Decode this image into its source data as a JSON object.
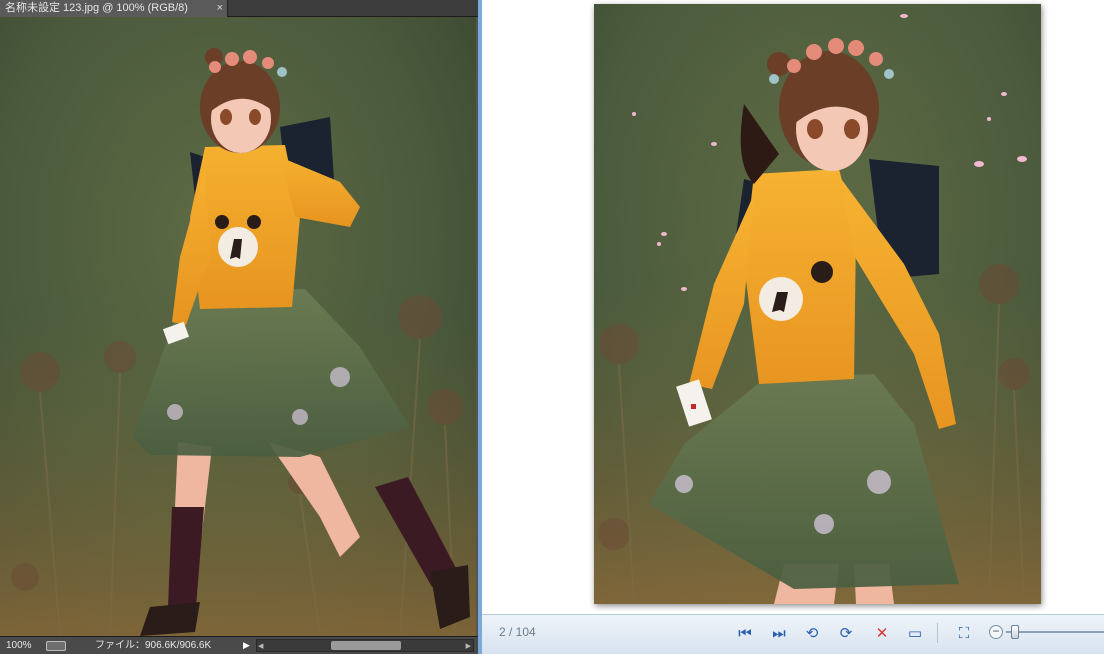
{
  "editor": {
    "document_tab": {
      "title": "名称未設定 123.jpg @ 100% (RGB/8)",
      "close_glyph": "×"
    },
    "status_bar": {
      "zoom": "100%",
      "file_info": "ファイル：906.6K/906.6K",
      "menu_arrow_glyph": "▶",
      "scroll_left_glyph": "◀",
      "scroll_right_glyph": "▶"
    }
  },
  "viewer": {
    "page_counter": "2 / 104",
    "toolbar": {
      "first_glyph": "⏮",
      "next_glyph": "⏭",
      "rotate_left_glyph": "⟲",
      "rotate_right_glyph": "⟳",
      "delete_glyph": "✕",
      "slideshow_glyph": "▭",
      "fit_glyph": "⛶",
      "zoom_out_glyph": "−",
      "zoom_level": 0.05
    }
  },
  "colors": {
    "accent": "#2a5fb0",
    "delete": "#d83a3a",
    "sweater": "#f3a92b",
    "skirt": "#56704a",
    "hair": "#6b3e28",
    "petal": "#f2b8d2"
  },
  "icons": {
    "tab_close": "close-icon",
    "first": "skip-to-first-icon",
    "next": "skip-to-next-icon",
    "rotate_left": "rotate-left-icon",
    "rotate_right": "rotate-right-icon",
    "delete": "delete-icon",
    "slideshow": "slideshow-icon",
    "fit": "fit-to-window-icon"
  }
}
